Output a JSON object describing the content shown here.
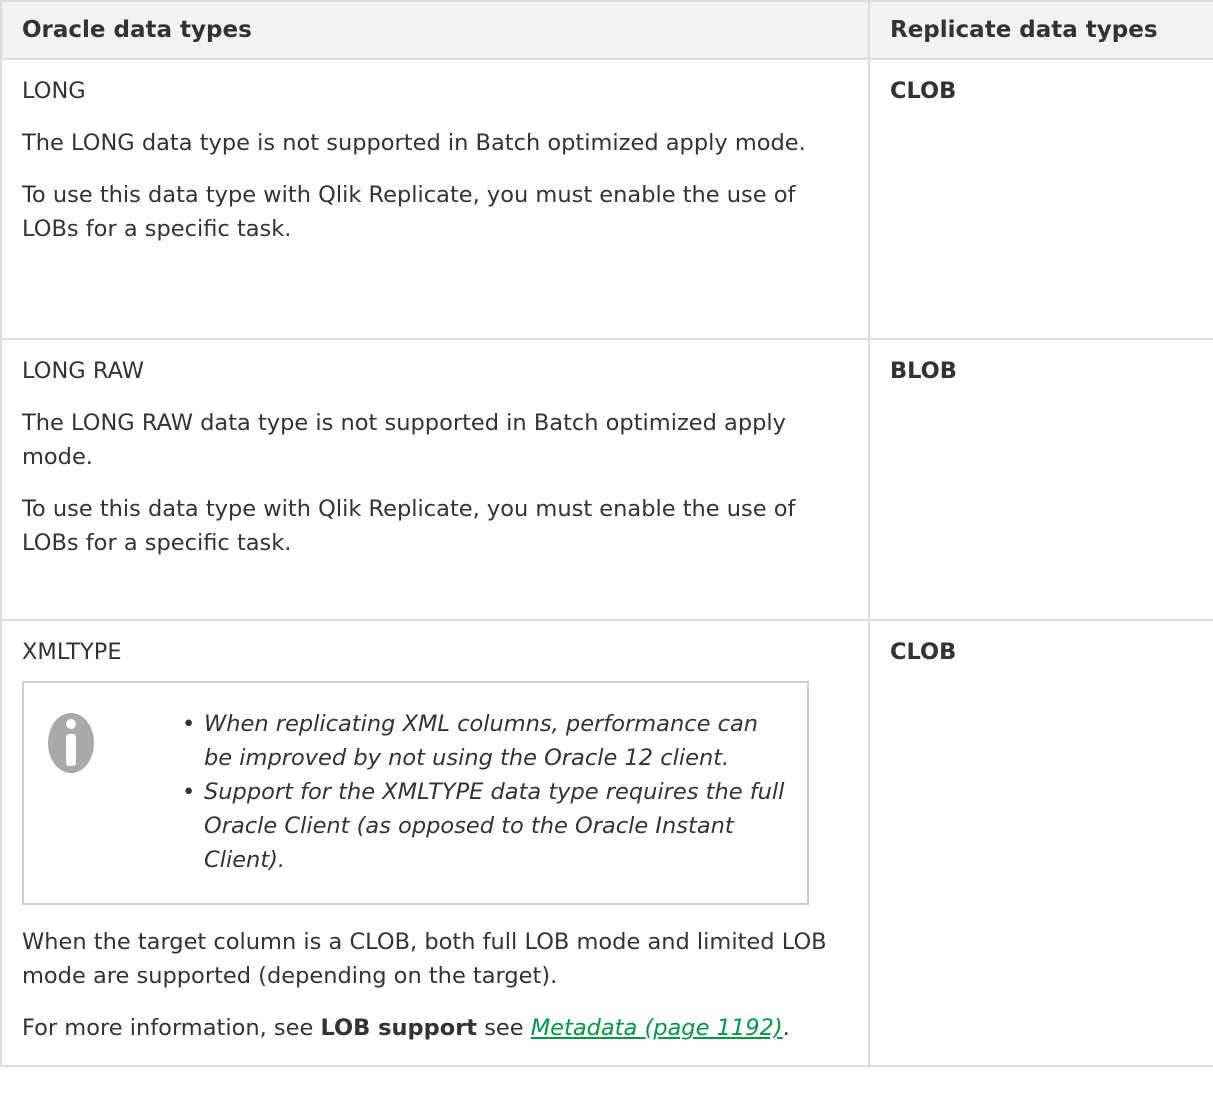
{
  "table": {
    "headers": [
      "Oracle data types",
      "Replicate data types"
    ],
    "rows": [
      {
        "oracle_type": "LONG",
        "paragraphs": [
          "The LONG data type is not supported in Batch optimized apply mode.",
          "To use this data type with Qlik Replicate, you must enable the use of LOBs for a specific task."
        ],
        "replicate_type": "CLOB"
      },
      {
        "oracle_type": "LONG RAW",
        "paragraphs": [
          "The LONG RAW data type is not supported in Batch optimized apply mode.",
          "To use this data type with Qlik Replicate, you must enable the use of LOBs for a specific task."
        ],
        "replicate_type": "BLOB"
      },
      {
        "oracle_type": "XMLTYPE",
        "note_items": [
          "When replicating XML columns, performance can be improved by not using the Oracle 12 client.",
          "Support for the XMLTYPE data type requires the full Oracle Client (as opposed to the Oracle Instant Client)."
        ],
        "paragraph_after": "When the target column is a CLOB, both full LOB mode and limited LOB mode are supported (depending on the target).",
        "more_info": {
          "prefix": "For more information, see ",
          "bold": "LOB support",
          "middle": " see ",
          "link": "Metadata (page 1192)",
          "suffix": "."
        },
        "replicate_type": "CLOB"
      }
    ]
  },
  "icons": {
    "note": "info-icon"
  },
  "colors": {
    "link": "#009845",
    "header_bg": "#f2f2f2",
    "border": "#dcdcdc",
    "icon": "#a9a9a9"
  }
}
